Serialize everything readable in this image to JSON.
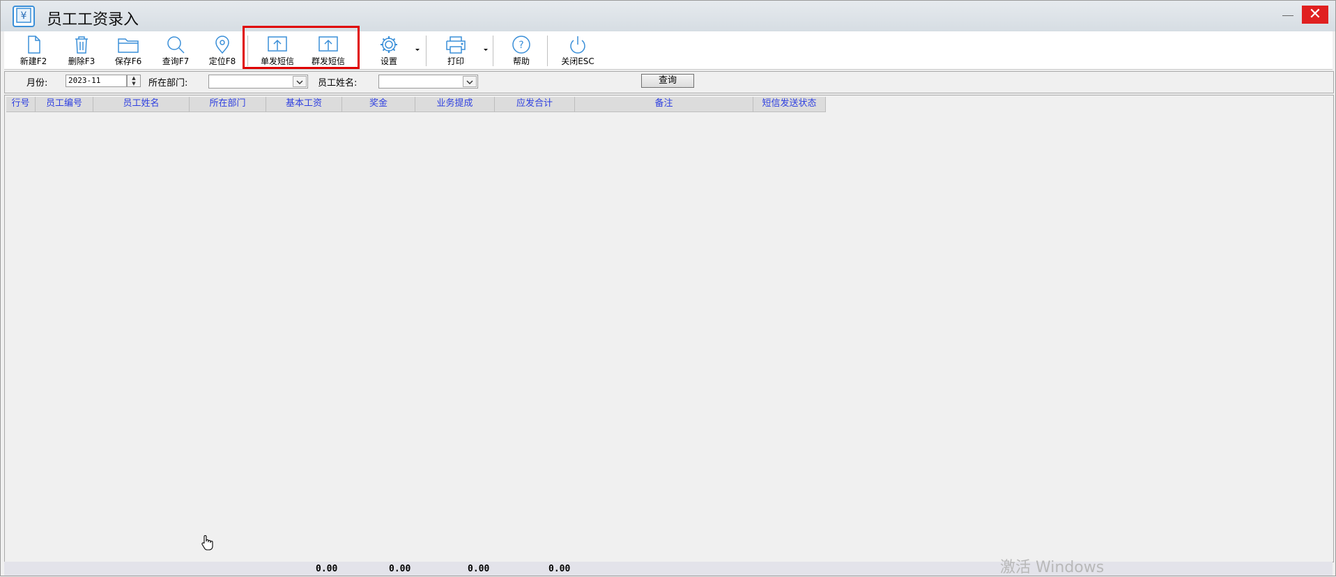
{
  "window": {
    "title": "员工工资录入",
    "close_glyph": "✕"
  },
  "toolbar": {
    "new_label": "新建F2",
    "delete_label": "删除F3",
    "save_label": "保存F6",
    "query_label": "查询F7",
    "locate_label": "定位F8",
    "single_sms_label": "单发短信",
    "group_sms_label": "群发短信",
    "settings_label": "设置",
    "print_label": "打印",
    "help_label": "帮助",
    "close_label": "关闭ESC"
  },
  "filters": {
    "month_label": "月份:",
    "month_value": "2023-11",
    "department_label": "所在部门:",
    "department_value": "",
    "employee_name_label": "员工姓名:",
    "employee_name_value": "",
    "query_button": "查询"
  },
  "table": {
    "columns": [
      "行号",
      "员工编号",
      "员工姓名",
      "所在部门",
      "基本工资",
      "奖金",
      "业务提成",
      "应发合计",
      "备注",
      "短信发送状态"
    ],
    "rows": []
  },
  "totals": {
    "basic_salary": "0.00",
    "bonus": "0.00",
    "commission": "0.00",
    "gross_total": "0.00"
  },
  "watermark": "激活 Windows",
  "colors": {
    "header_text": "#2e3fe0",
    "icon_blue": "#3a8fd8",
    "highlight_border": "#e00000",
    "close_button": "#e02020"
  }
}
